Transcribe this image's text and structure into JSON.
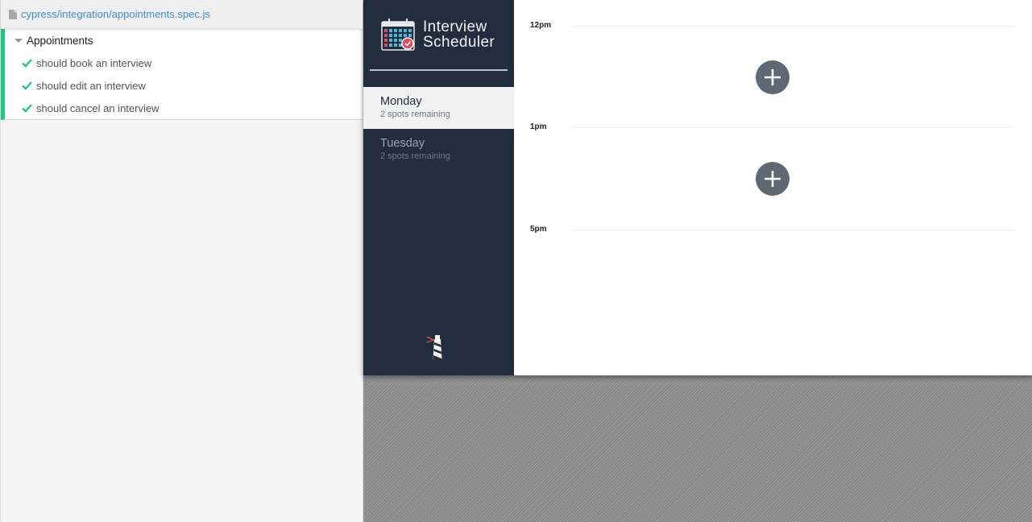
{
  "reporter": {
    "spec_path": "cypress/integration/appointments.spec.js",
    "suite_title": "Appointments",
    "tests": [
      {
        "label": "should book an interview",
        "status": "passed"
      },
      {
        "label": "should edit an interview",
        "status": "passed"
      },
      {
        "label": "should cancel an interview",
        "status": "passed"
      }
    ]
  },
  "app": {
    "brand": {
      "line1": "Interview",
      "line2": "Scheduler"
    },
    "days": [
      {
        "name": "Monday",
        "spots": "2 spots remaining",
        "selected": true
      },
      {
        "name": "Tuesday",
        "spots": "2 spots remaining",
        "selected": false
      }
    ],
    "slots": [
      {
        "time": "12pm",
        "empty": true
      },
      {
        "time": "1pm",
        "empty": true
      },
      {
        "time": "5pm",
        "empty": false
      }
    ]
  },
  "colors": {
    "pass_green": "#1fc784",
    "sidebar_bg": "#222e3e",
    "add_button": "#5f6773",
    "link_blue": "#3a8fd0"
  },
  "icons": [
    "file-icon",
    "caret-down-icon",
    "check-icon",
    "calendar-logo-icon",
    "add-icon",
    "lighthouse-icon"
  ]
}
